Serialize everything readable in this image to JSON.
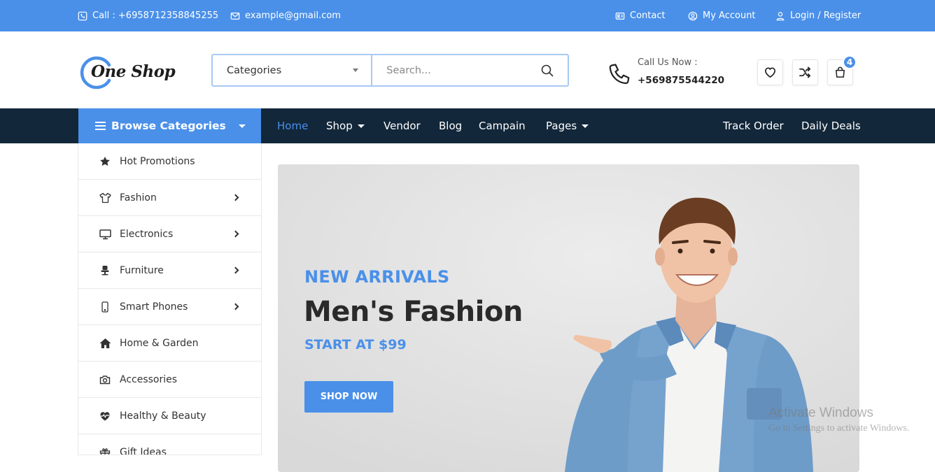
{
  "topbar": {
    "call": "Call : +6958712358845255",
    "email": "example@gmail.com",
    "contact": "Contact",
    "my_account": "My Account",
    "login_register": "Login / Register"
  },
  "header": {
    "logo_text": "One Shop",
    "search": {
      "category_label": "Categories",
      "placeholder": "Search..."
    },
    "call_label": "Call Us Now :",
    "call_number": "+569875544220",
    "cart_count": "4"
  },
  "nav": {
    "browse_label": "Browse Categories",
    "links": [
      "Home",
      "Shop",
      "Vendor",
      "Blog",
      "Campain",
      "Pages"
    ],
    "right_links": [
      "Track Order",
      "Daily Deals"
    ]
  },
  "sidebar": {
    "items": [
      {
        "label": "Hot Promotions",
        "icon": "star-icon",
        "has_submenu": false
      },
      {
        "label": "Fashion",
        "icon": "tshirt-icon",
        "has_submenu": true
      },
      {
        "label": "Electronics",
        "icon": "monitor-icon",
        "has_submenu": true
      },
      {
        "label": "Furniture",
        "icon": "chair-icon",
        "has_submenu": true
      },
      {
        "label": "Smart Phones",
        "icon": "phone-icon",
        "has_submenu": true
      },
      {
        "label": "Home & Garden",
        "icon": "home-icon",
        "has_submenu": false
      },
      {
        "label": "Accessories",
        "icon": "camera-icon",
        "has_submenu": false
      },
      {
        "label": "Healthy & Beauty",
        "icon": "heartbeat-icon",
        "has_submenu": false
      },
      {
        "label": "Gift Ideas",
        "icon": "gift-icon",
        "has_submenu": false
      }
    ]
  },
  "hero": {
    "eyebrow": "NEW ARRIVALS",
    "title": "Men's Fashion",
    "subtitle": "START AT $99",
    "button": "SHOP NOW"
  },
  "watermark": {
    "line1": "Activate Windows",
    "line2": "Go to Settings to activate Windows."
  },
  "colors": {
    "primary": "#4a90e9",
    "nav_dark": "#12273a",
    "hero_bg": "#e1e1e2"
  }
}
